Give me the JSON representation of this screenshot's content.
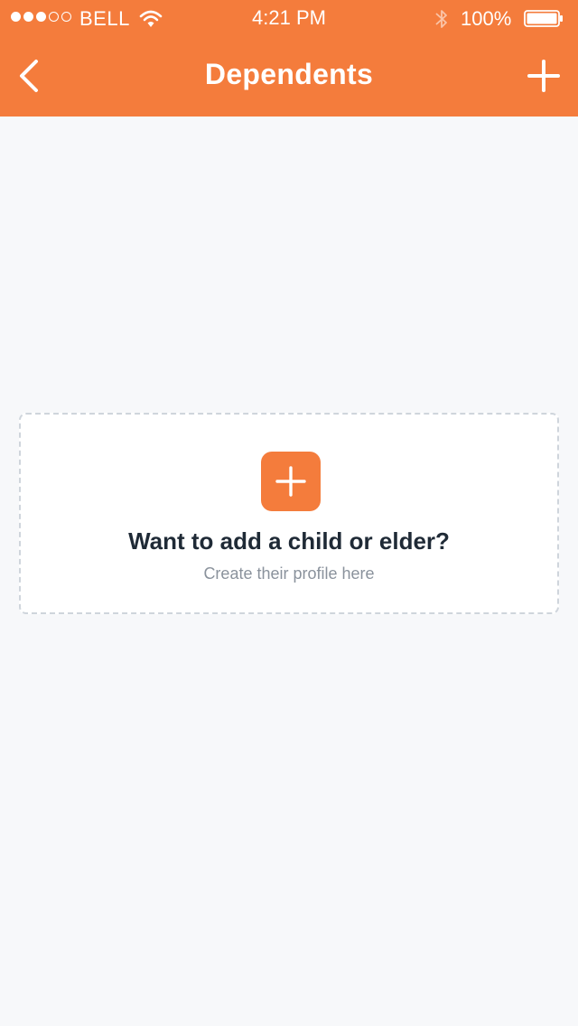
{
  "status_bar": {
    "carrier": "BELL",
    "time": "4:21 PM",
    "battery": "100%",
    "signal_bars_filled": 3,
    "signal_bars_total": 5
  },
  "nav": {
    "title": "Dependents",
    "back_icon": "chevron-left-icon",
    "add_icon": "plus-icon"
  },
  "empty_state": {
    "title": "Want to add a child or elder?",
    "subtitle": "Create their profile here",
    "icon": "plus-icon"
  },
  "colors": {
    "accent": "#f47c3c",
    "background": "#f7f8fa",
    "card_border": "#cfd5dc",
    "title_text": "#1f2a36",
    "subtitle_text": "#8a929c"
  }
}
